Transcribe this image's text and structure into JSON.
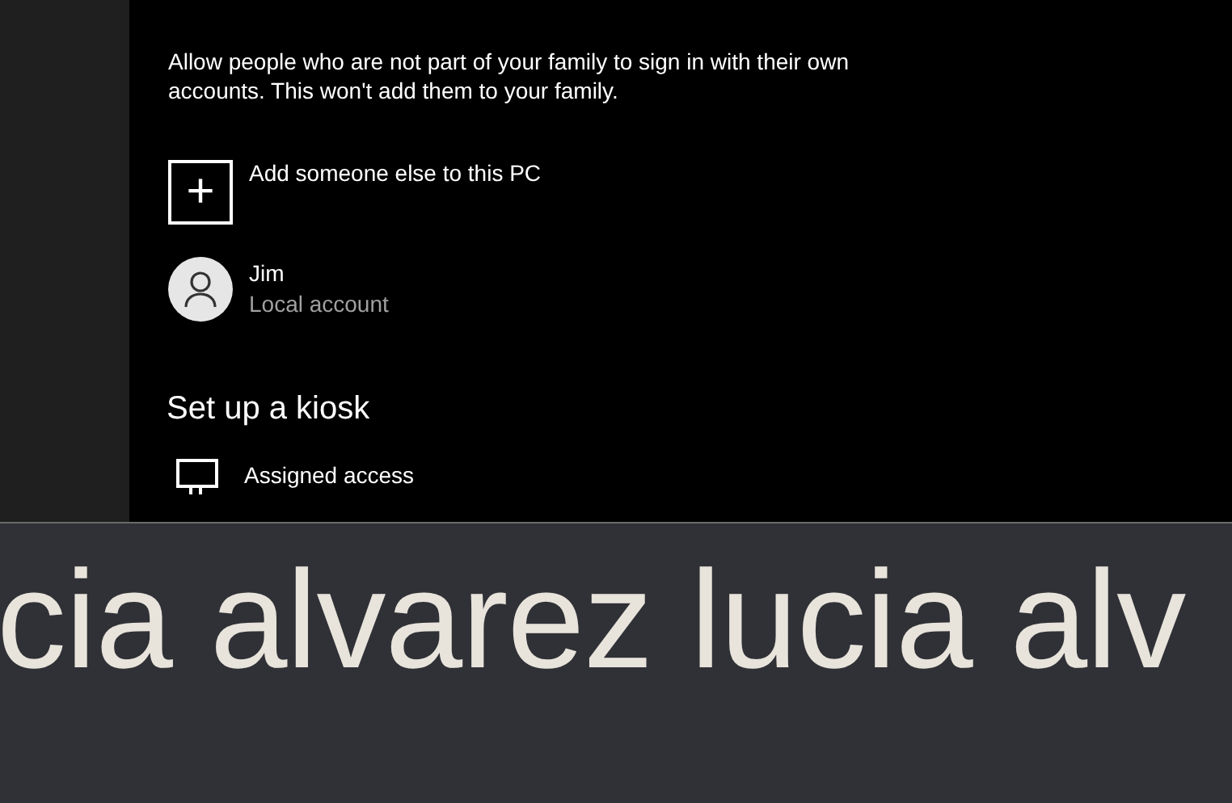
{
  "other_users": {
    "description": "Allow people who are not part of your family to sign in with their own accounts. This won't add them to your family.",
    "add_button": {
      "icon": "+",
      "label": "Add someone else to this PC"
    },
    "accounts": [
      {
        "name": "Jim",
        "type": "Local account"
      }
    ]
  },
  "kiosk": {
    "heading": "Set up a kiosk",
    "items": [
      {
        "label": "Assigned access"
      }
    ]
  },
  "zoomed_text": {
    "line": "cia alvarez lucia alv"
  }
}
